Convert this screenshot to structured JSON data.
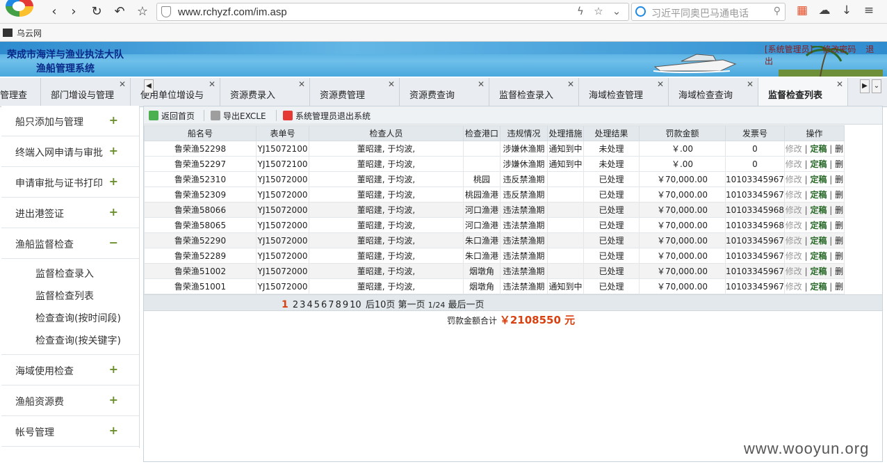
{
  "browser": {
    "url": "www.rchyzf.com/im.asp",
    "search_placeholder": "习近平同奥巴马通电话",
    "bookmark": "乌云网"
  },
  "banner": {
    "title_line1": "荣成市海洋与渔业执法大队",
    "title_line2": "渔船管理系统",
    "links": [
      "[系统管理员]",
      "修改密码",
      "退出"
    ]
  },
  "tabs": [
    {
      "label": "管理查",
      "active": false
    },
    {
      "label": "部门增设与管理",
      "active": false
    },
    {
      "label": "使用单位增设与",
      "active": false
    },
    {
      "label": "资源费录入",
      "active": false
    },
    {
      "label": "资源费管理",
      "active": false
    },
    {
      "label": "资源费查询",
      "active": false
    },
    {
      "label": "监督检查录入",
      "active": false
    },
    {
      "label": "海域检查管理",
      "active": false
    },
    {
      "label": "海域检查查询",
      "active": false
    },
    {
      "label": "监督检查列表",
      "active": true
    }
  ],
  "sidebar": {
    "items": [
      {
        "label": "船只添加与管理",
        "toggle": "+"
      },
      {
        "label": "终端入网申请与审批",
        "toggle": "+"
      },
      {
        "label": "申请审批与证书打印",
        "toggle": "+"
      },
      {
        "label": "进出港签证",
        "toggle": "+"
      },
      {
        "label": "渔船监督检查",
        "toggle": "−"
      },
      {
        "label": "海域使用检查",
        "toggle": "+"
      },
      {
        "label": "渔船资源费",
        "toggle": "+"
      },
      {
        "label": "帐号管理",
        "toggle": "+"
      }
    ],
    "sub_items": [
      "监督检查录入",
      "监督检查列表",
      "检查查询(按时间段)",
      "检查查询(按关键字)"
    ]
  },
  "toolbar": {
    "home": "返回首页",
    "export": "导出EXCLE",
    "logout": "系统管理员退出系统"
  },
  "table": {
    "headers": [
      "船名号",
      "表单号",
      "检查人员",
      "检查港口",
      "违规情况",
      "处理措施",
      "处理结果",
      "罚款金额",
      "发票号",
      "操作"
    ],
    "op_edit": "修改",
    "op_view": "定稿",
    "op_del": "删",
    "rows": [
      [
        "鲁荣渔52298",
        "YJ15072100",
        "董昭建, 于均波,",
        "",
        "涉嫌休渔期",
        "通知到中",
        "未处理",
        "￥.00",
        "0"
      ],
      [
        "鲁荣渔52297",
        "YJ15072100",
        "董昭建, 于均波,",
        "",
        "涉嫌休渔期",
        "通知到中",
        "未处理",
        "￥.00",
        "0"
      ],
      [
        "鲁荣渔52310",
        "YJ15072000",
        "董昭建, 于均波,",
        "桃园",
        "违反禁渔期",
        "",
        "已处理",
        "￥70,000.00",
        "10103345967"
      ],
      [
        "鲁荣渔52309",
        "YJ15072000",
        "董昭建, 于均波,",
        "桃园渔港",
        "违反禁渔期",
        "",
        "已处理",
        "￥70,000.00",
        "10103345967"
      ],
      [
        "鲁荣渔58066",
        "YJ15072000",
        "董昭建, 于均波,",
        "河口渔港",
        "违法禁渔期",
        "",
        "已处理",
        "￥70,000.00",
        "10103345968"
      ],
      [
        "鲁荣渔58065",
        "YJ15072000",
        "董昭建, 于均波,",
        "河口渔港",
        "违法禁渔期",
        "",
        "已处理",
        "￥70,000.00",
        "10103345968"
      ],
      [
        "鲁荣渔52290",
        "YJ15072000",
        "董昭建, 于均波,",
        "朱口渔港",
        "违法禁渔期",
        "",
        "已处理",
        "￥70,000.00",
        "10103345967"
      ],
      [
        "鲁荣渔52289",
        "YJ15072000",
        "董昭建, 于均波,",
        "朱口渔港",
        "违法禁渔期",
        "",
        "已处理",
        "￥70,000.00",
        "10103345967"
      ],
      [
        "鲁荣渔51002",
        "YJ15072000",
        "董昭建, 于均波,",
        "烟墩角",
        "违法禁渔期",
        "",
        "已处理",
        "￥70,000.00",
        "10103345967"
      ],
      [
        "鲁荣渔51001",
        "YJ15072000",
        "董昭建, 于均波,",
        "烟墩角",
        "违法禁渔期",
        "通知到中",
        "已处理",
        "￥70,000.00",
        "10103345967"
      ]
    ]
  },
  "pager": {
    "current": "1",
    "pages": [
      "2",
      "3",
      "4",
      "5",
      "6",
      "7",
      "8",
      "9",
      "10"
    ],
    "next10": "后10页",
    "first": "第一页",
    "position": "1/24",
    "last": "最后一页"
  },
  "total": {
    "label": "罚款金额合计",
    "amount": "￥2108550 元"
  },
  "watermark": "www.wooyun.org",
  "colors": {
    "accent": "#d9400f",
    "banner": "#3d9fd8",
    "title": "#0a2a8a"
  }
}
